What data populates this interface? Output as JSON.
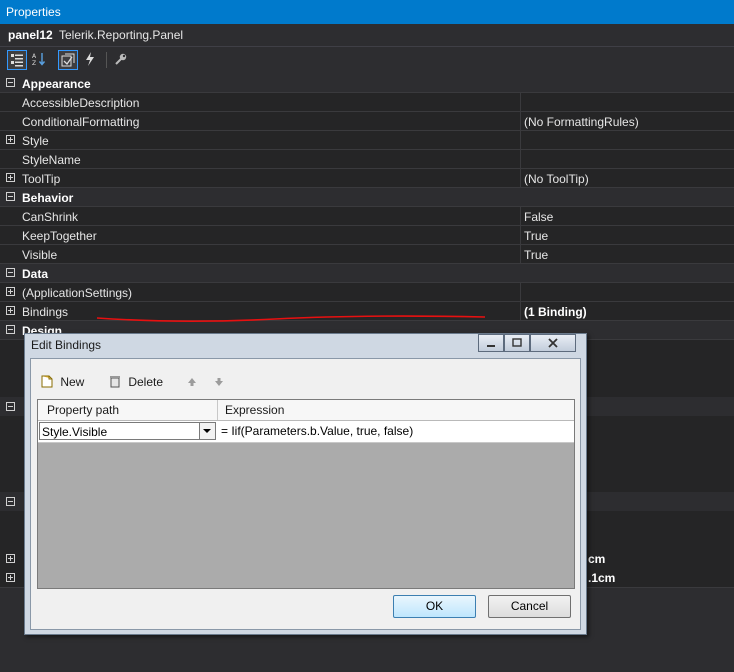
{
  "window": {
    "title": "Properties"
  },
  "selector": {
    "object_name": "panel12",
    "object_type": "Telerik.Reporting.Panel"
  },
  "toolbar": {
    "icons": [
      "categorized-icon",
      "alphabetical-icon",
      "properties-icon",
      "events-icon",
      "property-pages-icon"
    ]
  },
  "grid": {
    "rows": [
      {
        "kind": "category",
        "expanded": true,
        "name": "Appearance",
        "value": ""
      },
      {
        "kind": "property",
        "name": "AccessibleDescription",
        "value": ""
      },
      {
        "kind": "property",
        "name": "ConditionalFormatting",
        "value": "(No FormattingRules)"
      },
      {
        "kind": "property",
        "expandable": true,
        "name": "Style",
        "value": ""
      },
      {
        "kind": "property",
        "name": "StyleName",
        "value": ""
      },
      {
        "kind": "property",
        "expandable": true,
        "name": "ToolTip",
        "value": "(No ToolTip)"
      },
      {
        "kind": "category",
        "expanded": true,
        "name": "Behavior",
        "value": ""
      },
      {
        "kind": "property",
        "name": "CanShrink",
        "value": "False"
      },
      {
        "kind": "property",
        "name": "KeepTogether",
        "value": "True"
      },
      {
        "kind": "property",
        "name": "Visible",
        "value": "True"
      },
      {
        "kind": "category",
        "expanded": true,
        "name": "Data",
        "value": ""
      },
      {
        "kind": "property",
        "expandable": true,
        "name": "(ApplicationSettings)",
        "value": ""
      },
      {
        "kind": "property",
        "expandable": true,
        "name": "Bindings",
        "value": "(1 Binding)",
        "bold_value": true
      },
      {
        "kind": "category",
        "expanded": true,
        "name": "Design",
        "value": ""
      }
    ],
    "partial_values": [
      "cm",
      ".1cm"
    ]
  },
  "dialog": {
    "title": "Edit Bindings",
    "toolbar": {
      "new_label": "New",
      "delete_label": "Delete"
    },
    "columns": {
      "property_path": "Property path",
      "expression": "Expression"
    },
    "binding": {
      "property_path": "Style.Visible",
      "expression": "= Iif(Parameters.b.Value, true, false)"
    },
    "ok_label": "OK",
    "cancel_label": "Cancel"
  },
  "colors": {
    "title_bar": "#007acc",
    "annotation": "#e81010"
  }
}
